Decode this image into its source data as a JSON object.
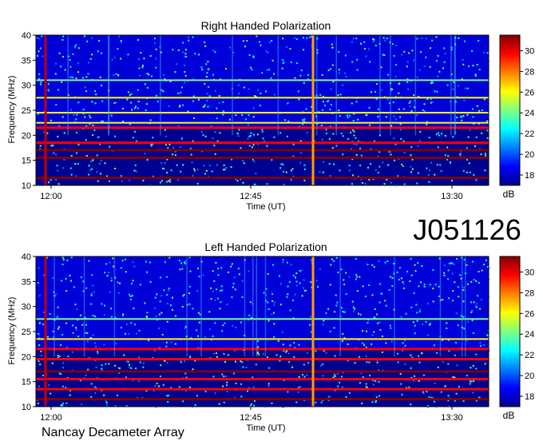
{
  "figure_id": "J051126",
  "footer_label": "Nancay Decameter Array",
  "colorbar_colors": [
    "#00008f",
    "#0000ff",
    "#0080ff",
    "#00ffff",
    "#80ff80",
    "#ffff00",
    "#ff8000",
    "#ff0000",
    "#800000"
  ],
  "chart_data": [
    {
      "type": "heatmap",
      "title": "Right Handed Polarization",
      "xlabel": "Time (UT)",
      "ylabel": "Frequency (MHz)",
      "x_ticks": [
        "12:00",
        "12:45",
        "13:30"
      ],
      "y_ticks": [
        "10",
        "15",
        "20",
        "25",
        "30",
        "35",
        "40"
      ],
      "ylim": [
        10,
        40
      ],
      "colorbar": {
        "label": "dB",
        "ticks": [
          "18",
          "20",
          "22",
          "24",
          "26",
          "28",
          "30"
        ],
        "range": [
          17,
          31.5
        ]
      },
      "bands_MHz": [
        11.5,
        15.5,
        17,
        18.5,
        21.5,
        22.5,
        24.5,
        27.5,
        31
      ],
      "bursts_UT": [
        "11:59",
        "13:02"
      ]
    },
    {
      "type": "heatmap",
      "title": "Left Handed Polarization",
      "xlabel": "Time (UT)",
      "ylabel": "Frequency (MHz)",
      "x_ticks": [
        "12:00",
        "12:45",
        "13:30"
      ],
      "y_ticks": [
        "10",
        "15",
        "20",
        "25",
        "30",
        "35",
        "40"
      ],
      "ylim": [
        10,
        40
      ],
      "colorbar": {
        "label": "dB",
        "ticks": [
          "18",
          "20",
          "22",
          "24",
          "26",
          "28",
          "30"
        ],
        "range": [
          17,
          31.5
        ]
      },
      "bands_MHz": [
        11.5,
        13.5,
        15.5,
        17,
        19.5,
        21.5,
        23.5,
        27.5
      ],
      "bursts_UT": [
        "11:59",
        "13:02"
      ]
    }
  ]
}
